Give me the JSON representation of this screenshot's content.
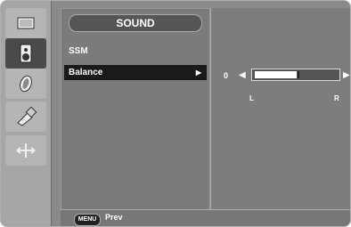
{
  "menu_title": "SOUND",
  "menu_items": [
    {
      "label": "SSM",
      "selected": false
    },
    {
      "label": "Balance",
      "selected": true
    }
  ],
  "balance": {
    "value": "0",
    "left_label": "L",
    "right_label": "R",
    "level_fraction": 0.5
  },
  "footer": {
    "key_label": "MENU",
    "action_label": "Prev"
  },
  "rail_icons": [
    "picture-icon",
    "sound-icon",
    "color-icon",
    "setup-icon",
    "function-icon"
  ]
}
